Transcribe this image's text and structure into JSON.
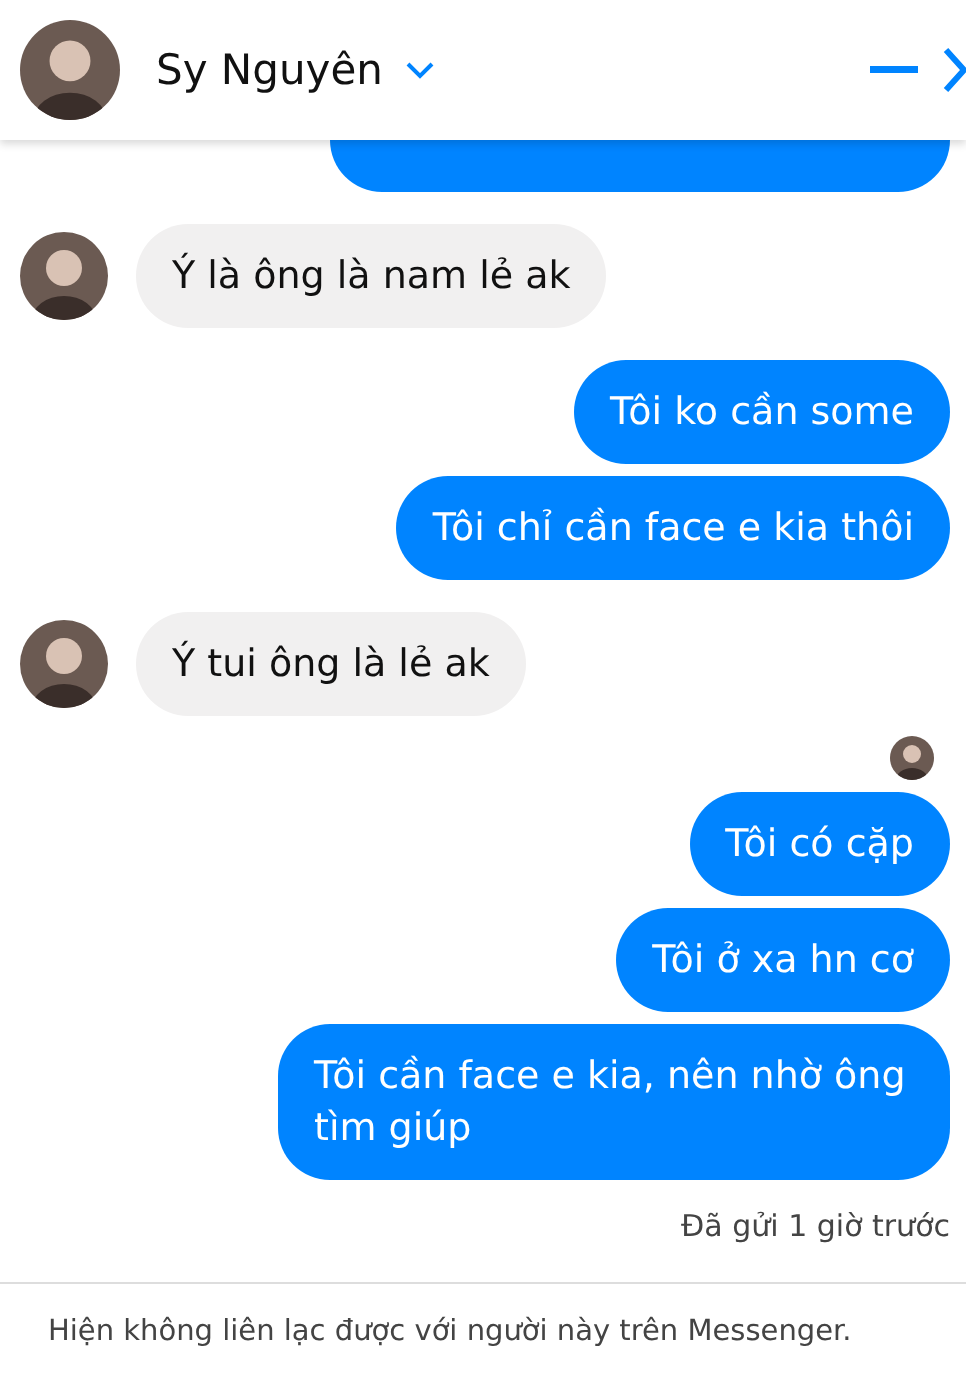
{
  "header": {
    "name": "Sy Nguyên"
  },
  "messages": [
    {
      "kind": "sent-cut"
    },
    {
      "kind": "received",
      "text": "Ý là ông là nam lẻ ak"
    },
    {
      "kind": "sent",
      "text": "Tôi ko cần some"
    },
    {
      "kind": "sent",
      "text": "Tôi chỉ cần face e kia thôi"
    },
    {
      "kind": "received",
      "text": "Ý tui ông là lẻ ak"
    },
    {
      "kind": "seen"
    },
    {
      "kind": "sent",
      "text": "Tôi có cặp"
    },
    {
      "kind": "sent",
      "text": "Tôi ở xa hn cơ"
    },
    {
      "kind": "sent",
      "text": "Tôi cần face e kia, nên nhờ ông tìm giúp"
    }
  ],
  "status": "Đã gửi 1 giờ trước",
  "footer": "Hiện không liên lạc được với người này trên Messenger."
}
